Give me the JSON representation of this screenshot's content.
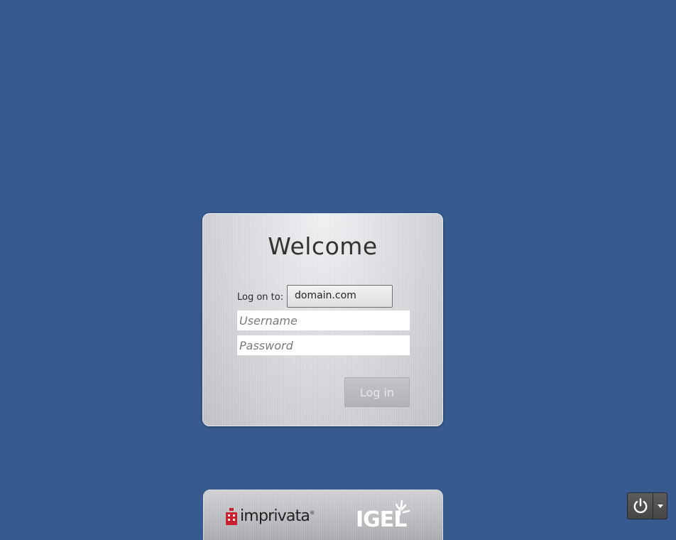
{
  "login": {
    "title": "Welcome",
    "logon_label": "Log on to:",
    "domain_value": "domain.com",
    "username_placeholder": "Username",
    "password_placeholder": "Password",
    "login_button_label": "Log in"
  },
  "branding": {
    "imprivata_text": "imprivata",
    "imprivata_registered_mark": "®",
    "igel_text": "IGEL"
  },
  "icons": {
    "power_button": "power-icon",
    "power_menu": "caret-down-icon",
    "imprivata_logo_mark": "imprivata-logo-icon",
    "igel_logo_mark": "igel-rays-icon"
  },
  "colors": {
    "desktop_background": "#375b8f",
    "imprivata_red": "#c8202f",
    "igel_white": "#ffffff",
    "login_button_text": "#e8e8e8"
  }
}
